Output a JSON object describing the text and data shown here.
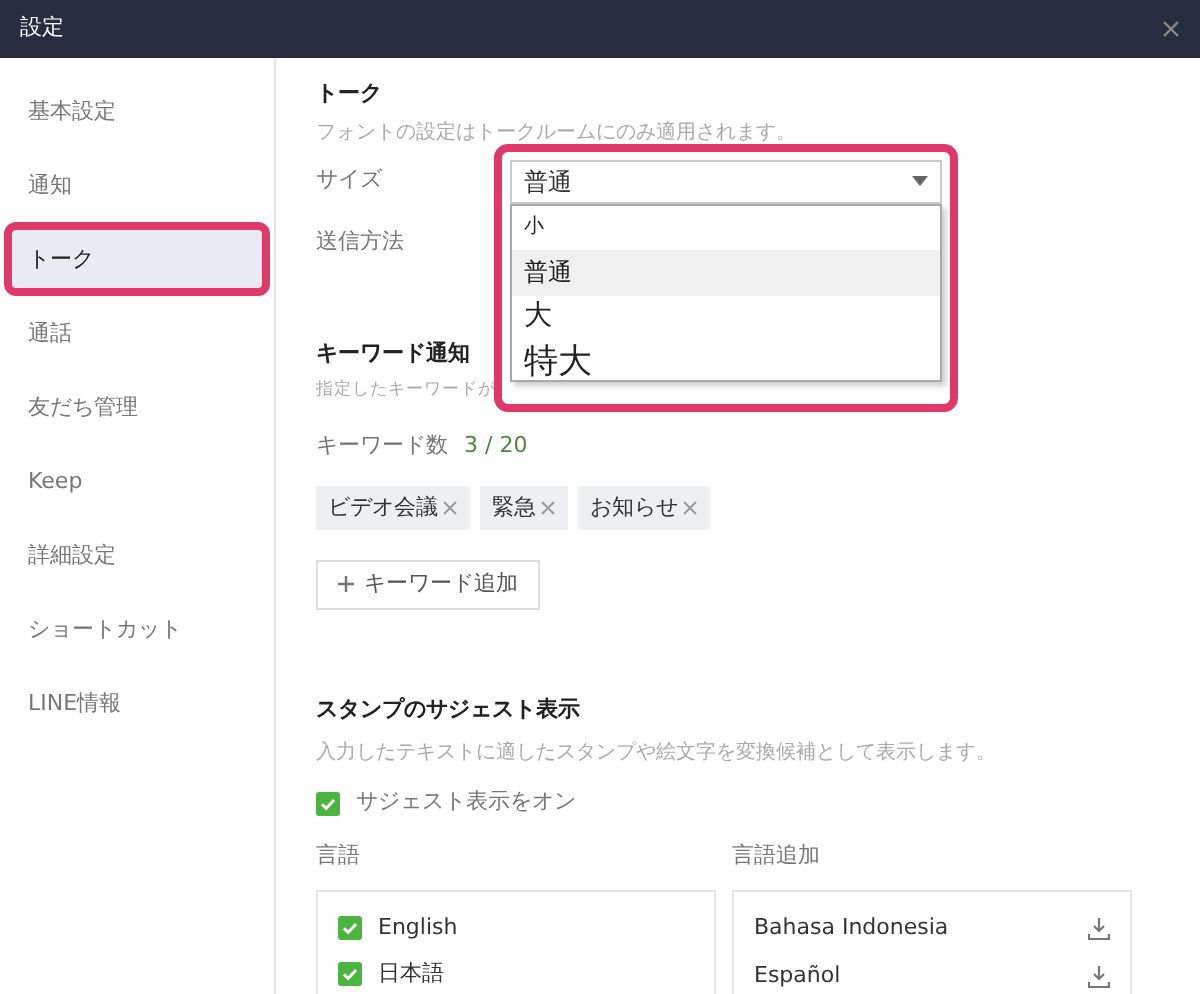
{
  "window": {
    "title": "設定"
  },
  "sidebar": {
    "items": [
      {
        "label": "基本設定",
        "selected": false,
        "highlighted": false
      },
      {
        "label": "通知",
        "selected": false,
        "highlighted": false
      },
      {
        "label": "トーク",
        "selected": true,
        "highlighted": true
      },
      {
        "label": "通話",
        "selected": false,
        "highlighted": false
      },
      {
        "label": "友だち管理",
        "selected": false,
        "highlighted": false
      },
      {
        "label": "Keep",
        "selected": false,
        "highlighted": false
      },
      {
        "label": "詳細設定",
        "selected": false,
        "highlighted": false
      },
      {
        "label": "ショートカット",
        "selected": false,
        "highlighted": false
      },
      {
        "label": "LINE情報",
        "selected": false,
        "highlighted": false
      }
    ]
  },
  "talk": {
    "heading": "トーク",
    "description": "フォントの設定はトークルームにのみ適用されます。",
    "size": {
      "label": "サイズ",
      "value": "普通",
      "expanded": true,
      "highlighted": true,
      "options": [
        {
          "label": "小",
          "selected": false
        },
        {
          "label": "普通",
          "selected": true
        },
        {
          "label": "大",
          "selected": false
        },
        {
          "label": "特大",
          "selected": false
        }
      ]
    },
    "send_method": {
      "label": "送信方法"
    }
  },
  "keywords": {
    "heading": "キーワード通知",
    "description": "指定したキーワードが",
    "count_label": "キーワード数",
    "count": "3 / 20",
    "tags": [
      {
        "label": "ビデオ会議"
      },
      {
        "label": "緊急"
      },
      {
        "label": "お知らせ"
      }
    ],
    "add_button": "キーワード追加"
  },
  "stamps": {
    "heading": "スタンプのサジェスト表示",
    "description": "入力したテキストに適したスタンプや絵文字を変換候補として表示します。",
    "toggle": {
      "label": "サジェスト表示をオン",
      "checked": true
    },
    "languages": {
      "heading": "言語",
      "items": [
        {
          "label": "English",
          "checked": true
        },
        {
          "label": "日本語",
          "checked": true
        }
      ]
    },
    "add_languages": {
      "heading": "言語追加",
      "items": [
        {
          "label": "Bahasa Indonesia"
        },
        {
          "label": "Español"
        }
      ]
    }
  }
}
